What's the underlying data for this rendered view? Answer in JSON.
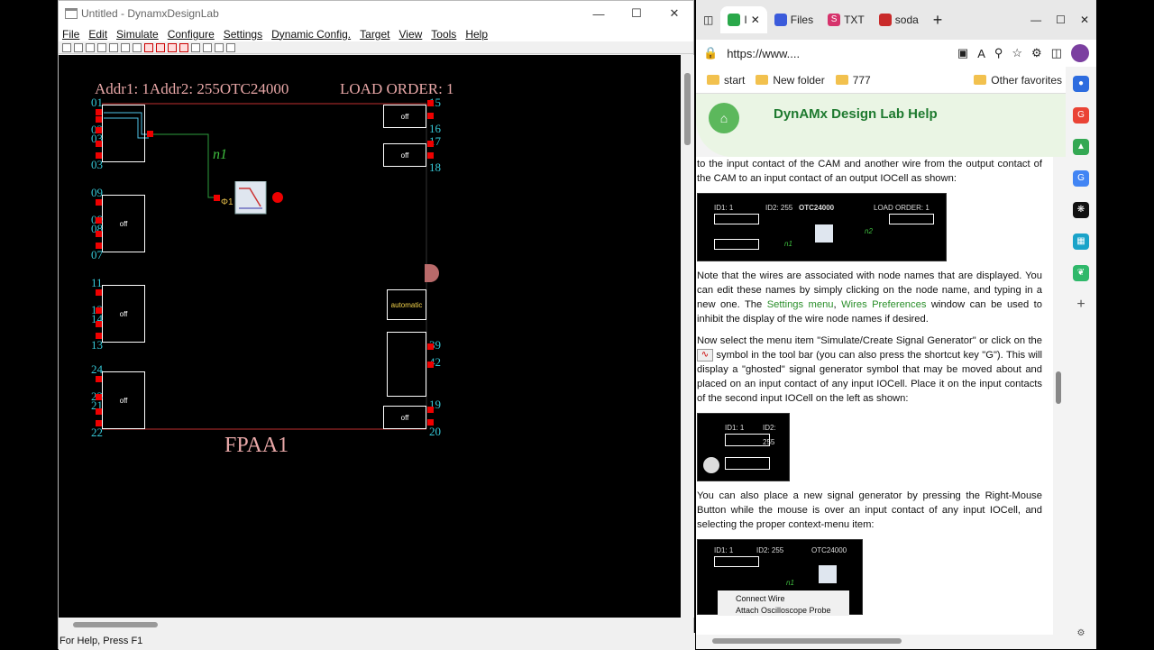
{
  "app": {
    "title": "Untitled - DynamxDesignLab",
    "menu": [
      "File",
      "Edit",
      "Simulate",
      "Configure",
      "Settings",
      "Dynamic Config.",
      "Target",
      "View",
      "Tools",
      "Help"
    ],
    "status": "For Help, Press F1",
    "canvas": {
      "header_addr": "Addr1: 1Addr2: 255OTC24000",
      "load_order": "LOAD ORDER: 1",
      "chip_name": "FPAA1",
      "node_name": "n1",
      "cell_off": "off",
      "cell_automatic": "automatic",
      "left_pins": [
        "01",
        "02",
        "03",
        "03",
        "09",
        "08",
        "08",
        "07",
        "11",
        "12",
        "14",
        "13",
        "24",
        "23",
        "21",
        "22"
      ],
      "right_pins": [
        "15",
        "16",
        "17",
        "18",
        "39",
        "42",
        "19",
        "20"
      ]
    }
  },
  "browser": {
    "tabs": [
      {
        "label": "I",
        "color": "#2aa84a"
      },
      {
        "label": "Files",
        "color": "#3b5bdb"
      },
      {
        "label": "TXT",
        "color": "#d6336c"
      },
      {
        "label": "soda",
        "color": "#c92a2a"
      }
    ],
    "url": "https://www....",
    "bookmarks": [
      "start",
      "New folder",
      "777"
    ],
    "other_favorites": "Other favorites",
    "help_title": "DynAMx Design Lab Help",
    "para1": "to the input contact of the CAM and another wire from the output contact of the CAM to an input contact of an output IOCell as shown:",
    "para2_a": "Note that the wires are associated with node names that are displayed. You can edit these names by simply clicking on the node name, and typing in a new one. The ",
    "link_settings": "Settings menu",
    "link_wires": "Wires Preferences",
    "para2_b": " window can be used to inhibit the display of the wire node names if desired.",
    "para3_a": "Now select the menu item \"Simulate/Create Signal Generator\" or click on the",
    "para3_b": " symbol in the tool bar (you can also press the shortcut key \"G\"). This will display a \"ghosted\" signal generator symbol that may be moved about and placed on an input contact of any input IOCell. Place it on the input contacts of the second input IOCell on the left as shown:",
    "para4": "You can also place a new signal generator by pressing the Right-Mouse Button while the mouse is over an input contact of any input IOCell, and selecting the proper context-menu item:",
    "shot1": {
      "id1": "ID1: 1",
      "id2": "ID2: 255",
      "chip": "OTC24000",
      "load": "LOAD ORDER: 1",
      "n1": "n1",
      "n2": "n2"
    },
    "shot2": {
      "id1": "ID1: 1",
      "id2": "ID2: 255"
    },
    "shot3": {
      "id1": "ID1: 1",
      "id2": "ID2: 255",
      "chip": "OTC24000",
      "n1": "n1",
      "menu1": "Connect Wire",
      "menu2": "Attach Oscilloscope Probe"
    }
  }
}
